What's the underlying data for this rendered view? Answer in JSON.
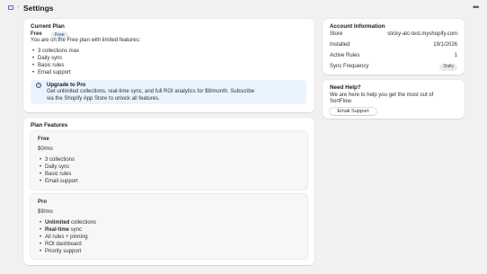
{
  "header": {
    "title": "Settings"
  },
  "current_plan": {
    "title": "Current Plan",
    "plan_name": "Free",
    "badge": "Free",
    "description": "You are on the Free plan with limited features:",
    "features": [
      "3 collections max",
      "Daily sync",
      "Basic rules",
      "Email support"
    ],
    "banner": {
      "title": "Upgrade to Pro",
      "line1": "Get unlimited collections, real-time sync, and full ROI analytics for $9/month. Subscribe",
      "line2": "via the Shopify App Store to unlock all features."
    }
  },
  "plan_features": {
    "title": "Plan Features",
    "plans": [
      {
        "name": "Free",
        "price": "$0/mo",
        "features": [
          {
            "strong": "",
            "text": "3 collections"
          },
          {
            "strong": "",
            "text": "Daily sync"
          },
          {
            "strong": "",
            "text": "Basic rules"
          },
          {
            "strong": "",
            "text": "Email support"
          }
        ]
      },
      {
        "name": "Pro",
        "price": "$9/mo",
        "features": [
          {
            "strong": "Unlimited",
            "text": " collections"
          },
          {
            "strong": "Real-time",
            "text": " sync"
          },
          {
            "strong": "",
            "text": "All rules + pinning"
          },
          {
            "strong": "",
            "text": "ROI dashboard"
          },
          {
            "strong": "",
            "text": "Priority support"
          }
        ]
      }
    ]
  },
  "account": {
    "title": "Account Information",
    "rows": [
      {
        "label": "Store",
        "value": "sticky-atc-test.myshopify.com"
      },
      {
        "label": "Installed",
        "value": "19/1/2026"
      },
      {
        "label": "Active Rules",
        "value": "1"
      },
      {
        "label": "Sync Frequency",
        "value": "Daily"
      }
    ]
  },
  "help": {
    "title": "Need Help?",
    "line1": "We are here to help you get the most out of",
    "line2": "SortFlow.",
    "button": "Email Support"
  },
  "colors": {
    "background": "#f1f1f1",
    "card": "#ffffff",
    "info_banner": "#eaf4ff",
    "badge_info": "#e4ecf7"
  }
}
